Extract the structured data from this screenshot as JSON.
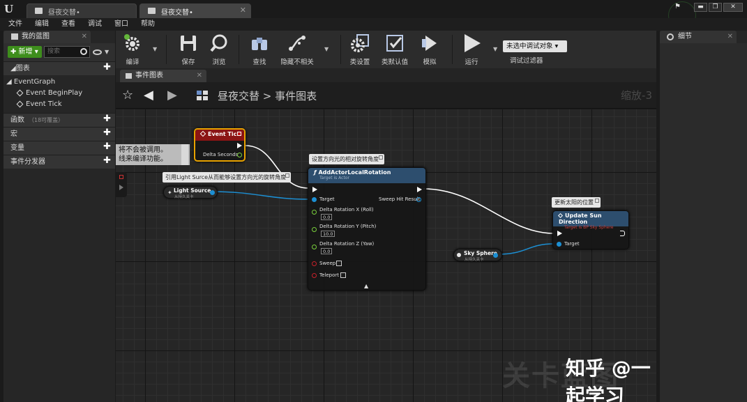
{
  "titlebar": {
    "tabs": [
      {
        "label": "昼夜交替•",
        "active": false
      },
      {
        "label": "昼夜交替•",
        "active": true
      }
    ],
    "window_controls": {
      "minimize": "▬",
      "maximize": "❐",
      "close": "✕"
    }
  },
  "menu": [
    "文件",
    "编辑",
    "查看",
    "调试",
    "窗口",
    "帮助"
  ],
  "my_blueprint": {
    "tab_label": "我的蓝图",
    "add_label": "✚ 新增 ▾",
    "search_placeholder": "搜索",
    "sections": {
      "graphs": "◢图表",
      "functions": "函数",
      "functions_note": "（18可覆盖）",
      "macros": "宏",
      "variables": "变量",
      "dispatchers": "事件分发器"
    },
    "tree": {
      "root": "◢ EventGraph",
      "items": [
        "Event BeginPlay",
        "Event Tick"
      ]
    }
  },
  "toolbar": {
    "compile": "编译",
    "save": "保存",
    "browse": "浏览",
    "find": "查找",
    "hide_unrelated": "隐藏不相关",
    "class_settings": "类设置",
    "class_defaults": "类默认值",
    "simulate": "模拟",
    "run": "运行",
    "debug_select": "未选中调试对象 ▾",
    "debug_filter": "调试过滤器"
  },
  "graph_tab": {
    "label": "事件图表"
  },
  "breadcrumb": {
    "root": "昼夜交替",
    "sep": ">",
    "current": "事件图表"
  },
  "zoom_label": "缩放-3",
  "graph": {
    "left_clip_text": [
      "将不会被调用。",
      "线来编译功能。"
    ],
    "event_tick": {
      "title": "Event Tick",
      "pin_delta": "Delta Seconds"
    },
    "light_comment": "引用Light Surce从而能够设置方向光的旋转角度",
    "light_source": {
      "title": "Light Source",
      "sub": "从持久关卡"
    },
    "rotation_comment": "设置方向光的相对旋转角度",
    "add_rotation": {
      "title": "AddActorLocalRotation",
      "sub": "Target is Actor",
      "target": "Target",
      "sweep_hit": "Sweep Hit Result",
      "roll_label": "Delta Rotation X (Roll)",
      "roll_value": "0.0",
      "pitch_label": "Delta Rotation Y (Pitch)",
      "pitch_value": "10.0",
      "yaw_label": "Delta Rotation Z (Yaw)",
      "yaw_value": "0.0",
      "sweep": "Sweep",
      "teleport": "Teleport"
    },
    "sun_comment": "更新太阳的位置",
    "update_sun": {
      "title": "Update Sun Direction",
      "sub": "Target is BP Sky Sphere",
      "target": "Target"
    },
    "sky_sphere": {
      "title": "Sky Sphere",
      "sub": "从持久关卡"
    }
  },
  "watermark": {
    "faded": "关卡蓝图",
    "credit": "知乎 @一起学习"
  },
  "details_panel": {
    "tab_label": "细节"
  },
  "colors": {
    "add_button": "#3e8e1c",
    "exec_wire": "#ffffff",
    "object_wire": "#1c8fd3",
    "event_header": "#8b1414",
    "function_header": "#2d4e6e",
    "selected_outline": "#e8a200"
  }
}
